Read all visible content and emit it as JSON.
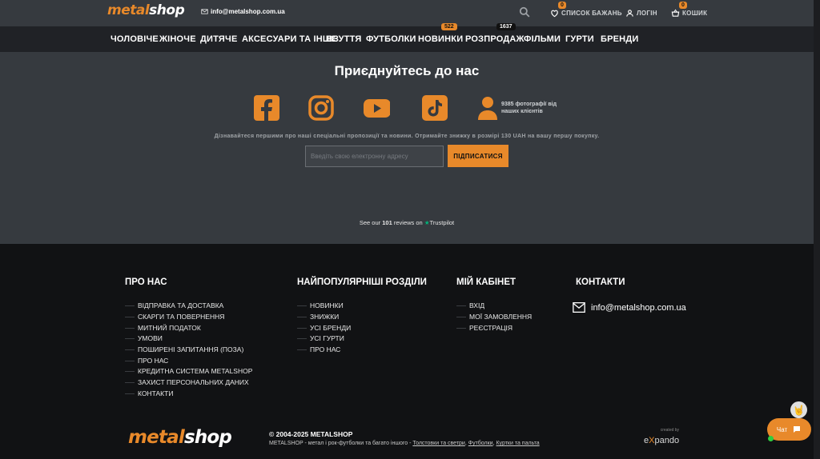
{
  "header": {
    "logo_left": "metal",
    "logo_right": "shop",
    "email": "info@metalshop.com.ua",
    "wishlist_label": "СПИСОК БАЖАНЬ",
    "wishlist_count": "0",
    "login_label": "ЛОГІН",
    "cart_label": "КОШИК",
    "cart_count": "0"
  },
  "nav": {
    "items": [
      "ЧОЛОВІЧЕ",
      "ЖІНОЧЕ",
      "ДИТЯЧЕ",
      "АКСЕСУАРИ ТА ІНШЕ",
      "ВЗУТТЯ",
      "ФУТБОЛКИ",
      "НОВИНКИ",
      "РОЗПРОДАЖ",
      "ФІЛЬМИ",
      "ГУРТИ",
      "БРЕНДИ"
    ],
    "new_badge": "522",
    "sale_badge": "1637"
  },
  "join": {
    "title": "Приєднуйтесь до нас",
    "social": [
      "facebook-icon",
      "instagram-icon",
      "youtube-icon",
      "tiktok-icon"
    ],
    "clients_text": "9385 фотографії від наших клієнтів",
    "promo": "Дізнавайтеся першими про наші спеціальні пропозиції та новини. Отримайте знижку в розмірі 130 UAH на вашу першу покупку.",
    "email_placeholder": "Введіть свою електронну адресу",
    "subscribe_label": "ПІДПИСАТИСЯ",
    "trust_prefix": "See our",
    "trust_count": "101",
    "trust_suffix": "reviews on",
    "trust_brand": "Trustpilot"
  },
  "footer": {
    "about": {
      "title": "ПРО НАС",
      "items": [
        "ВІДПРАВКА ТА ДОСТАВКА",
        "СКАРГИ ТА ПОВЕРНЕННЯ",
        "МИТНИЙ ПОДАТОК",
        "УМОВИ",
        "ПОШИРЕНІ ЗАПИТАННЯ (ПОЗА)",
        "ПРО НАС",
        "КРЕДИТНА СИСТЕМА METALSHOP",
        "ЗАХИСТ ПЕРСОНАЛЬНИХ ДАНИХ",
        "КОНТАКТИ"
      ]
    },
    "popular": {
      "title": "НАЙПОПУЛЯРНІШІ РОЗДІЛИ",
      "items": [
        "НОВИНКИ",
        "ЗНИЖКИ",
        "УСІ БРЕНДИ",
        "УСІ ГУРТИ",
        "ПРО НАС"
      ]
    },
    "account": {
      "title": "МІЙ КАБІНЕТ",
      "items": [
        "ВХІД",
        "МОЇ ЗАМОВЛЕННЯ",
        "РЕЄСТРАЦІЯ"
      ]
    },
    "contacts": {
      "title": "КОНТАКТИ",
      "email": "info@metalshop.com.ua"
    },
    "copyright": "© 2004-2025 METALSHOP",
    "desc_prefix": "METALSHOP - метал і рок-футболки та багато іншого -",
    "desc_links": [
      "Толстовки та светри",
      "Футболки",
      "Куртки та пальта"
    ],
    "credit_small": "created by",
    "credit_brand_a": "e",
    "credit_brand_x": "X",
    "credit_brand_b": "pando"
  },
  "chat": {
    "label": "Чат"
  },
  "colors": {
    "accent": "#e8892a",
    "topbar": "#363a3f",
    "nav": "#202226",
    "footer": "#111214"
  }
}
